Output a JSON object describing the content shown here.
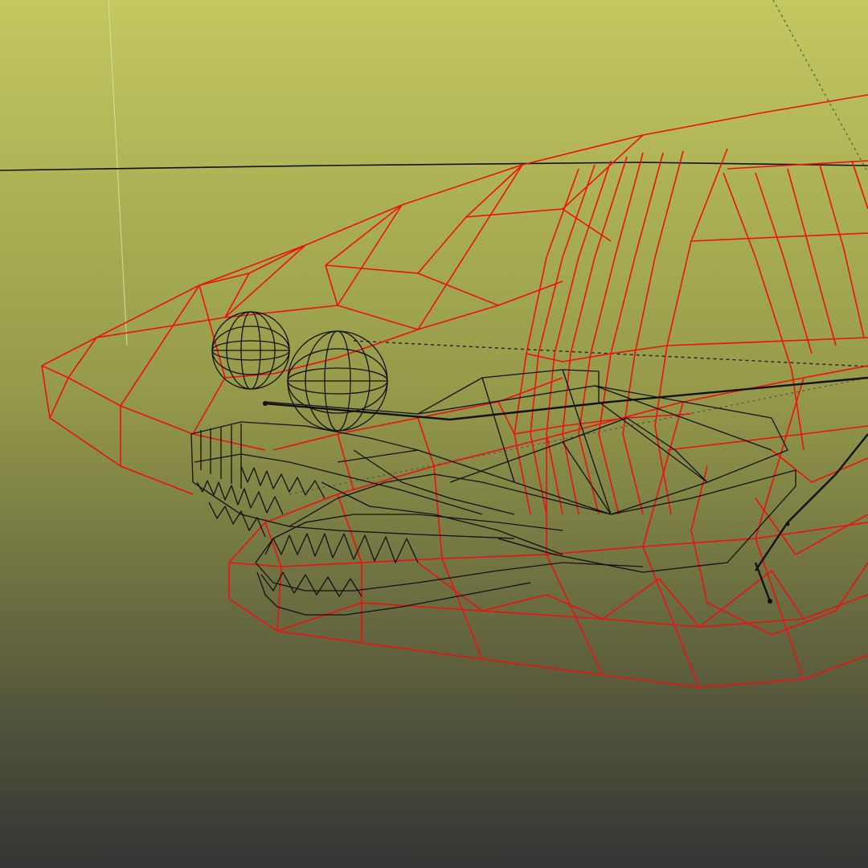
{
  "viewport": {
    "background_top": "#c3c860",
    "background_mid": "#959a4a",
    "background_bottom": "#343434",
    "mesh_color": "#ee1010",
    "rig_color": "#111111",
    "render_mode": "wireframe"
  }
}
